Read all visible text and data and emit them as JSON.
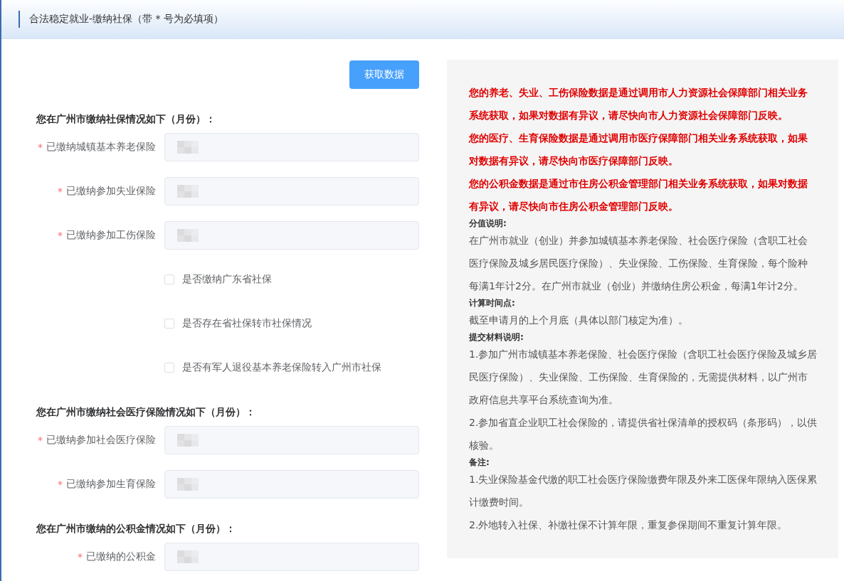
{
  "header": {
    "title": "合法稳定就业-缴纳社保（带 * 号为必填项）"
  },
  "fetch_button": {
    "label": "获取数据"
  },
  "required_mark": "*",
  "sections": [
    {
      "heading": "您在广州市缴纳社保情况如下（月份）：",
      "items": [
        {
          "kind": "field",
          "label": "已缴纳城镇基本养老保险",
          "required": true,
          "redacted": true
        },
        {
          "kind": "field",
          "label": "已缴纳参加失业保险",
          "required": true,
          "redacted": true
        },
        {
          "kind": "field",
          "label": "已缴纳参加工伤保险",
          "required": true,
          "redacted": true
        },
        {
          "kind": "checkbox",
          "label": "是否缴纳广东省社保",
          "checked": false
        },
        {
          "kind": "checkbox",
          "label": "是否存在省社保转市社保情况",
          "checked": false
        },
        {
          "kind": "checkbox",
          "label": "是否有军人退役基本养老保险转入广州市社保",
          "checked": false
        }
      ]
    },
    {
      "heading": "您在广州市缴纳社会医疗保险情况如下（月份）：",
      "items": [
        {
          "kind": "field",
          "label": "已缴纳参加社会医疗保险",
          "required": true,
          "redacted": true
        },
        {
          "kind": "field",
          "label": "已缴纳参加生育保险",
          "required": true,
          "redacted": true
        }
      ]
    },
    {
      "heading": "您在广州市缴纳的公积金情况如下（月份）：",
      "items": [
        {
          "kind": "field",
          "label": "已缴纳的公积金",
          "required": true,
          "redacted": true
        }
      ]
    }
  ],
  "notes": [
    {
      "kind": "alert",
      "text": "您的养老、失业、工伤保险数据是通过调用市人力资源社会保障部门相关业务系统获取，如果对数据有异议，请尽快向市人力资源社会保障部门反映。"
    },
    {
      "kind": "alert",
      "text": "您的医疗、生育保险数据是通过调用市医疗保障部门相关业务系统获取，如果对数据有异议，请尽快向市医疗保障部门反映。"
    },
    {
      "kind": "alert",
      "text": "您的公积金数据是通过市住房公积金管理部门相关业务系统获取，如果对数据有异议，请尽快向市住房公积金管理部门反映。"
    },
    {
      "kind": "heading",
      "text": "分值说明:"
    },
    {
      "kind": "paragraph",
      "text": "在广州市就业（创业）并参加城镇基本养老保险、社会医疗保险（含职工社会医疗保险及城乡居民医疗保险）、失业保险、工伤保险、生育保险，每个险种每满1年计2分。在广州市就业（创业）并缴纳住房公积金，每满1年计2分。"
    },
    {
      "kind": "heading",
      "text": "计算时间点:"
    },
    {
      "kind": "paragraph",
      "text": "截至申请月的上个月底（具体以部门核定为准）。"
    },
    {
      "kind": "heading",
      "text": "提交材料说明:"
    },
    {
      "kind": "paragraph",
      "text": "1.参加广州市城镇基本养老保险、社会医疗保险（含职工社会医疗保险及城乡居民医疗保险）、失业保险、工伤保险、生育保险的，无需提供材料，以广州市政府信息共享平台系统查询为准。"
    },
    {
      "kind": "paragraph",
      "text": "2.参加省直企业职工社会保险的，请提供省社保清单的授权码（条形码），以供核验。"
    },
    {
      "kind": "heading",
      "text": "备注:"
    },
    {
      "kind": "paragraph",
      "text": "1.失业保险基金代缴的职工社会医疗保险缴费年限及外来工医保年限纳入医保累计缴费时间。"
    },
    {
      "kind": "paragraph",
      "text": "2.外地转入社保、补缴社保不计算年限，重复参保期间不重复计算年限。"
    }
  ]
}
